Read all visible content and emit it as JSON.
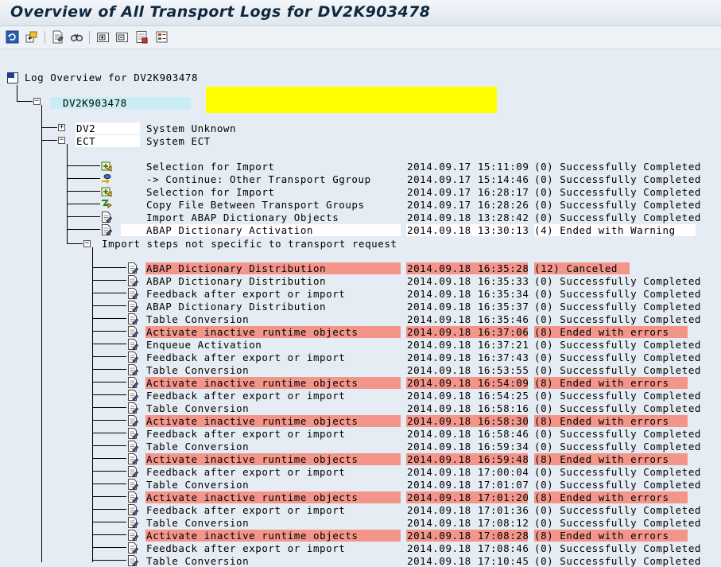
{
  "window": {
    "title": "Overview of All Transport Logs for DV2K903478"
  },
  "toolbar": {
    "icons": [
      "refresh-icon",
      "expand-subtree-icon",
      "display-log-icon",
      "find-icon",
      "expand-all-icon",
      "collapse-all-icon",
      "settings-icon",
      "legend-icon"
    ]
  },
  "tree": {
    "root_label": "Log Overview for DV2K903478",
    "request": {
      "id": "DV2K903478",
      "highlight_color": "#ffff00"
    },
    "systems": [
      {
        "id": "DV2",
        "status": "System Unknown"
      },
      {
        "id": "ECT",
        "status": "System ECT"
      }
    ],
    "ect_steps": [
      {
        "name": "Selection for Import",
        "timestamp": "2014.09.17 15:11:09",
        "result": "(0) Successfully Completed",
        "icon": "selection-icon"
      },
      {
        "name": "-> Continue: Other Transport Ggroup",
        "timestamp": "2014.09.17 15:14:46",
        "result": "(0) Successfully Completed",
        "icon": "continue-icon"
      },
      {
        "name": "Selection for Import",
        "timestamp": "2014.09.17 16:28:17",
        "result": "(0) Successfully Completed",
        "icon": "selection-icon"
      },
      {
        "name": "Copy File Between Transport Groups",
        "timestamp": "2014.09.17 16:28:26",
        "result": "(0) Successfully Completed",
        "icon": "copy-file-icon"
      },
      {
        "name": "Import ABAP Dictionary Objects",
        "timestamp": "2014.09.18 13:28:42",
        "result": "(0) Successfully Completed",
        "icon": "log-document-icon"
      },
      {
        "name": "ABAP Dictionary Activation",
        "timestamp": "2014.09.18 13:30:13",
        "result": "(4) Ended with Warning",
        "icon": "log-document-icon",
        "white": true
      }
    ],
    "import_group_label": "Import steps not specific to transport request",
    "import_steps": [
      {
        "name": "ABAP Dictionary Distribution",
        "timestamp": "2014.09.18 16:35:28",
        "result": "(12) Canceled",
        "error": true
      },
      {
        "name": "ABAP Dictionary Distribution",
        "timestamp": "2014.09.18 16:35:33",
        "result": "(0) Successfully Completed"
      },
      {
        "name": "Feedback after export or import",
        "timestamp": "2014.09.18 16:35:34",
        "result": "(0) Successfully Completed"
      },
      {
        "name": "ABAP Dictionary Distribution",
        "timestamp": "2014.09.18 16:35:37",
        "result": "(0) Successfully Completed"
      },
      {
        "name": "Table Conversion",
        "timestamp": "2014.09.18 16:35:46",
        "result": "(0) Successfully Completed"
      },
      {
        "name": "Activate inactive runtime objects",
        "timestamp": "2014.09.18 16:37:06",
        "result": "(8) Ended with errors",
        "error": true
      },
      {
        "name": "Enqueue Activation",
        "timestamp": "2014.09.18 16:37:21",
        "result": "(0) Successfully Completed"
      },
      {
        "name": "Feedback after export or import",
        "timestamp": "2014.09.18 16:37:43",
        "result": "(0) Successfully Completed"
      },
      {
        "name": "Table Conversion",
        "timestamp": "2014.09.18 16:53:55",
        "result": "(0) Successfully Completed"
      },
      {
        "name": "Activate inactive runtime objects",
        "timestamp": "2014.09.18 16:54:09",
        "result": "(8) Ended with errors",
        "error": true
      },
      {
        "name": "Feedback after export or import",
        "timestamp": "2014.09.18 16:54:25",
        "result": "(0) Successfully Completed"
      },
      {
        "name": "Table Conversion",
        "timestamp": "2014.09.18 16:58:16",
        "result": "(0) Successfully Completed"
      },
      {
        "name": "Activate inactive runtime objects",
        "timestamp": "2014.09.18 16:58:30",
        "result": "(8) Ended with errors",
        "error": true
      },
      {
        "name": "Feedback after export or import",
        "timestamp": "2014.09.18 16:58:46",
        "result": "(0) Successfully Completed"
      },
      {
        "name": "Table Conversion",
        "timestamp": "2014.09.18 16:59:34",
        "result": "(0) Successfully Completed"
      },
      {
        "name": "Activate inactive runtime objects",
        "timestamp": "2014.09.18 16:59:48",
        "result": "(8) Ended with errors",
        "error": true
      },
      {
        "name": "Feedback after export or import",
        "timestamp": "2014.09.18 17:00:04",
        "result": "(0) Successfully Completed"
      },
      {
        "name": "Table Conversion",
        "timestamp": "2014.09.18 17:01:07",
        "result": "(0) Successfully Completed"
      },
      {
        "name": "Activate inactive runtime objects",
        "timestamp": "2014.09.18 17:01:20",
        "result": "(8) Ended with errors",
        "error": true
      },
      {
        "name": "Feedback after export or import",
        "timestamp": "2014.09.18 17:01:36",
        "result": "(0) Successfully Completed"
      },
      {
        "name": "Table Conversion",
        "timestamp": "2014.09.18 17:08:12",
        "result": "(0) Successfully Completed"
      },
      {
        "name": "Activate inactive runtime objects",
        "timestamp": "2014.09.18 17:08:28",
        "result": "(8) Ended with errors",
        "error": true
      },
      {
        "name": "Feedback after export or import",
        "timestamp": "2014.09.18 17:08:46",
        "result": "(0) Successfully Completed"
      },
      {
        "name": "Table Conversion",
        "timestamp": "2014.09.18 17:10:45",
        "result": "(0) Successfully Completed"
      }
    ]
  },
  "colors": {
    "background": "#e6ecf3",
    "error_highlight": "#f4958a",
    "request_bg": "#c8eef4",
    "title_text": "#10283f"
  }
}
